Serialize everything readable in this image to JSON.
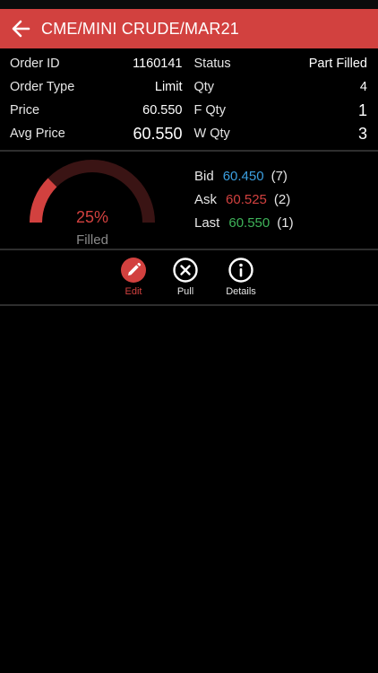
{
  "header": {
    "title": "CME/MINI CRUDE/MAR21",
    "back_icon": "arrow-left-icon"
  },
  "order": {
    "left": [
      {
        "label": "Order ID",
        "value": "1160141"
      },
      {
        "label": "Order Type",
        "value": "Limit"
      },
      {
        "label": "Price",
        "value": "60.550"
      },
      {
        "label": "Avg Price",
        "value": "60.550"
      }
    ],
    "right": [
      {
        "label": "Status",
        "value": "Part Filled"
      },
      {
        "label": "Qty",
        "value": "4"
      },
      {
        "label": "F Qty",
        "value": "1"
      },
      {
        "label": "W Qty",
        "value": "3"
      }
    ]
  },
  "fill": {
    "percent_label": "25%",
    "percent_value": 25,
    "status_label": "Filled"
  },
  "quotes": [
    {
      "label": "Bid",
      "price": "60.450",
      "size": "(7)",
      "color": "#3b9fe0"
    },
    {
      "label": "Ask",
      "price": "60.525",
      "size": "(2)",
      "color": "#d2413f"
    },
    {
      "label": "Last",
      "price": "60.550",
      "size": "(1)",
      "color": "#3fb45a"
    }
  ],
  "actions": [
    {
      "label": "Edit",
      "icon": "pencil-icon",
      "active": true
    },
    {
      "label": "Pull",
      "icon": "close-circle-icon",
      "active": false
    },
    {
      "label": "Details",
      "icon": "info-icon",
      "active": false
    }
  ],
  "colors": {
    "accent": "#d2413f",
    "gauge_track": "#3a1414",
    "background": "#000000"
  }
}
